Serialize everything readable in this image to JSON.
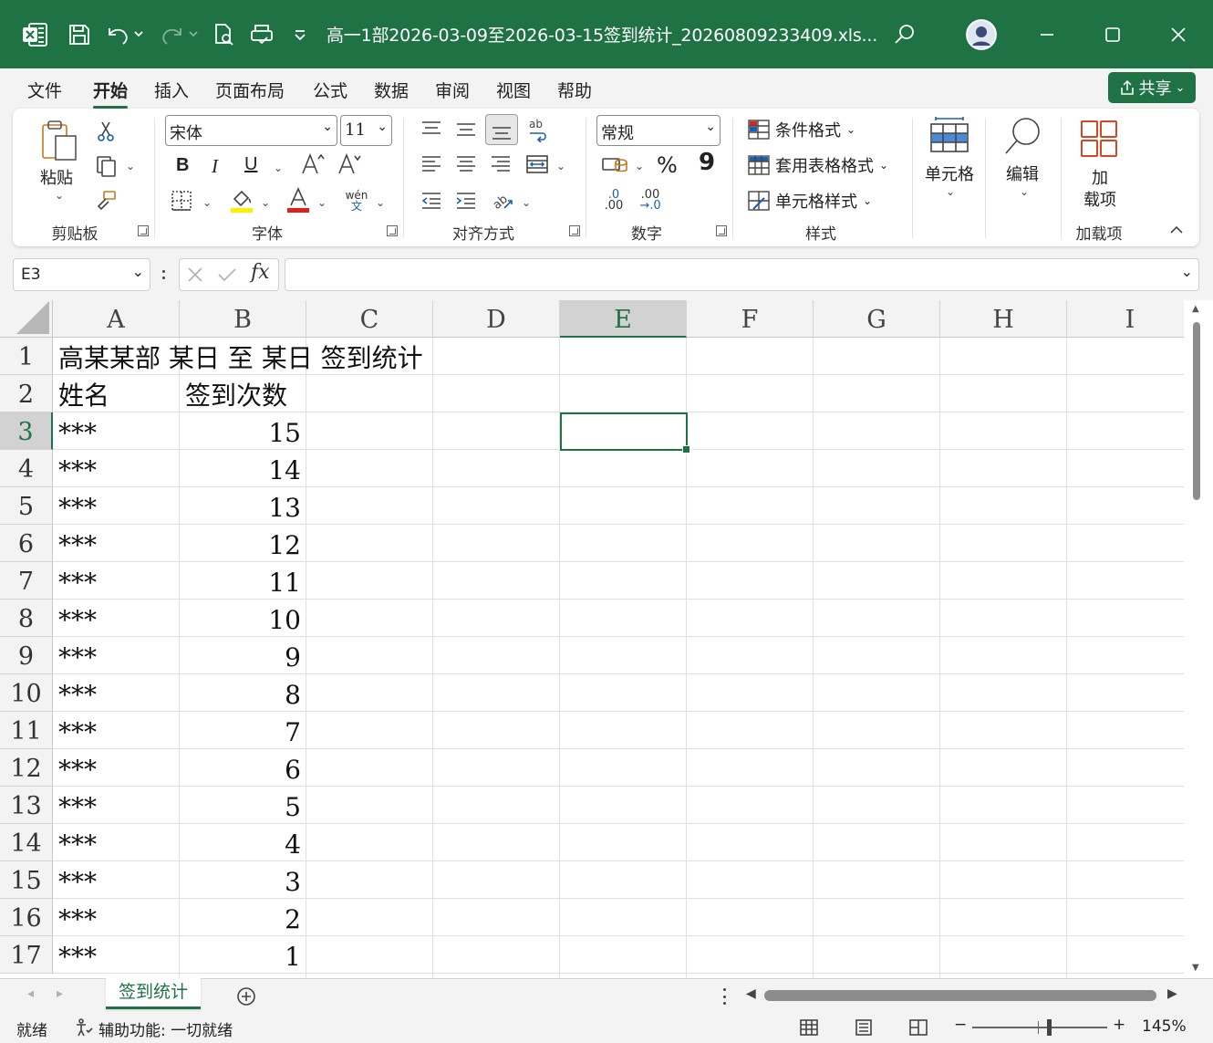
{
  "titlebar": {
    "doc_title": "高一1部2026-03-09至2026-03-15签到统计_20260809233409.xls...",
    "accent": "#1f7244"
  },
  "tabs": [
    {
      "label": "文件",
      "active": false
    },
    {
      "label": "开始",
      "active": true
    },
    {
      "label": "插入",
      "active": false
    },
    {
      "label": "页面布局",
      "active": false
    },
    {
      "label": "公式",
      "active": false
    },
    {
      "label": "数据",
      "active": false
    },
    {
      "label": "审阅",
      "active": false
    },
    {
      "label": "视图",
      "active": false
    },
    {
      "label": "帮助",
      "active": false
    }
  ],
  "share_label": "共享",
  "ribbon": {
    "clipboard": {
      "paste_label": "粘贴",
      "group_label": "剪贴板"
    },
    "font": {
      "font_name": "宋体",
      "font_size": "11",
      "group_label": "字体",
      "bold": "B",
      "italic": "I",
      "underline": "U",
      "phonetic_top": "wén",
      "phonetic_bottom": "文"
    },
    "alignment": {
      "group_label": "对齐方式"
    },
    "number": {
      "format": "常规",
      "group_label": "数字",
      "percent": "%",
      "comma": "9",
      "inc_decimal_top": ".0",
      "inc_decimal_bottom": ".00",
      "dec_decimal_top": ".00",
      "dec_decimal_bottom": "→.0"
    },
    "styles": {
      "conditional": "条件格式",
      "table_format": "套用表格格式",
      "cell_styles": "单元格样式",
      "group_label": "样式"
    },
    "cells": {
      "label": "单元格"
    },
    "editing": {
      "label": "编辑"
    },
    "addins": {
      "label_line1": "加",
      "label_line2": "载项",
      "group_label": "加载项"
    }
  },
  "formula_bar": {
    "name_box": "E3",
    "fx": "fx",
    "formula": ""
  },
  "sheet": {
    "columns": [
      "A",
      "B",
      "C",
      "D",
      "E",
      "F",
      "G",
      "H",
      "I"
    ],
    "selected_column": "E",
    "rows": [
      "1",
      "2",
      "3",
      "4",
      "5",
      "6",
      "7",
      "8",
      "9",
      "10",
      "11",
      "12",
      "13",
      "14",
      "15",
      "16",
      "17"
    ],
    "selected_row": "3",
    "title": "高某某部  某日  至  某日  签到统计",
    "header_name": "姓名",
    "header_count": "签到次数",
    "data": [
      {
        "name": "***",
        "count": "15"
      },
      {
        "name": "***",
        "count": "14"
      },
      {
        "name": "***",
        "count": "13"
      },
      {
        "name": "***",
        "count": "12"
      },
      {
        "name": "***",
        "count": "11"
      },
      {
        "name": "***",
        "count": "10"
      },
      {
        "name": "***",
        "count": "9"
      },
      {
        "name": "***",
        "count": "8"
      },
      {
        "name": "***",
        "count": "7"
      },
      {
        "name": "***",
        "count": "6"
      },
      {
        "name": "***",
        "count": "5"
      },
      {
        "name": "***",
        "count": "4"
      },
      {
        "name": "***",
        "count": "3"
      },
      {
        "name": "***",
        "count": "2"
      },
      {
        "name": "***",
        "count": "1"
      }
    ]
  },
  "sheet_tabs": [
    {
      "label": "签到统计",
      "active": true
    }
  ],
  "status": {
    "ready": "就绪",
    "accessibility": "辅助功能: 一切就绪",
    "zoom": "145%",
    "zoom_minus": "−",
    "zoom_plus": "+"
  }
}
